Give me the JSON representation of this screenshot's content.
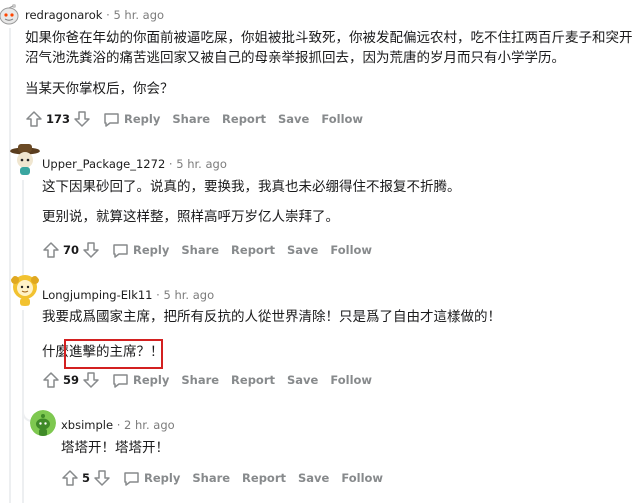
{
  "comments": [
    {
      "username": "redragonarok",
      "time": "5 hr. ago",
      "lines": [
        "如果你爸在年幼的你面前被逼吃屎，你姐被批斗致死，你被发配偏远农村，吃不住扛两百斤麦子和突开",
        "沼气池洗粪浴的痛苦逃回家又被自己的母亲举报抓回去，因为荒唐的岁月而只有小学学历。",
        "当某天你掌权后，你会？"
      ],
      "votes": "173"
    },
    {
      "username": "Upper_Package_1272",
      "time": "5 hr. ago",
      "lines": [
        "这下因果砂回了。说真的，要换我，我真也未必绷得住不报复不折腾。",
        "更别说，就算这样整，照样高呼万岁亿人崇拜了。"
      ],
      "votes": "70"
    },
    {
      "username": "Longjumping-Elk11",
      "time": "5 hr. ago",
      "lines": [
        "我要成爲國家主席，把所有反抗的人從世界清除！只是爲了自由才這樣做的！",
        "什麼進擊的主席？！"
      ],
      "votes": "59"
    },
    {
      "username": "xbsimple",
      "time": "2 hr. ago",
      "lines": [
        "塔塔开！塔塔开！"
      ],
      "votes": "5"
    }
  ],
  "actions": {
    "reply": "Reply",
    "share": "Share",
    "report": "Report",
    "save": "Save",
    "follow": "Follow"
  },
  "colors": {
    "meta_text": "#7c7c7c",
    "action_text": "#878a8c",
    "thread_line": "#edeff1",
    "highlight": "#d32020"
  }
}
